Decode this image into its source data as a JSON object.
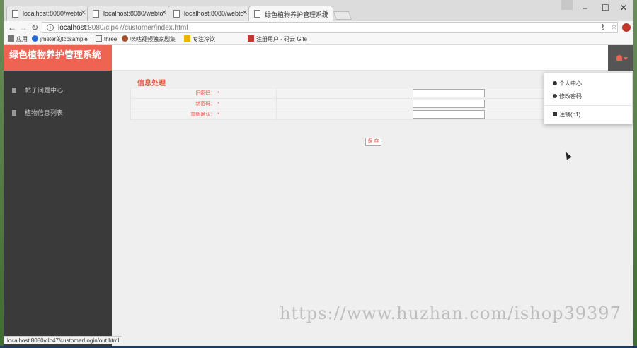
{
  "browser": {
    "tabs": [
      {
        "title": "localhost:8080/webto",
        "active": false
      },
      {
        "title": "localhost:8080/webto",
        "active": false
      },
      {
        "title": "localhost:8080/webto",
        "active": false
      },
      {
        "title": "绿色植物养护管理系统",
        "active": true
      }
    ],
    "address": {
      "host": "localhost",
      "path": ":8080/clp47/customer/index.html"
    },
    "bookmarks": [
      "应用",
      "jmeter的tcpsample",
      "three",
      "咪咕视频独家剧集",
      "专注冷饮",
      "注册用户 - 码云 Gite"
    ],
    "status_url": "localhost:8080/clp47/customerLogin/out.html"
  },
  "app": {
    "brand": "绿色植物养护管理系统",
    "sidebar": [
      {
        "label": "帖子问题中心"
      },
      {
        "label": "植物信息列表"
      }
    ],
    "section_title": "信息处理",
    "form": {
      "fields": [
        {
          "label": "旧密码：",
          "required": "*",
          "value": ""
        },
        {
          "label": "新密码：",
          "required": "*",
          "value": ""
        },
        {
          "label": "重新确认：",
          "required": "*",
          "value": ""
        }
      ],
      "save_label": "保 存"
    },
    "user_menu": {
      "items": [
        {
          "label": "个人中心",
          "icon": "user-icon"
        },
        {
          "label": "修改密码",
          "icon": "gear-icon"
        },
        {
          "label": "注销(p1)",
          "icon": "logout-icon"
        }
      ]
    }
  },
  "watermark": "https://www.huzhan.com/ishop39397",
  "colors": {
    "brand": "#ee6352",
    "sidebar": "#3a3a3a",
    "accent_text": "#e05a4a"
  }
}
